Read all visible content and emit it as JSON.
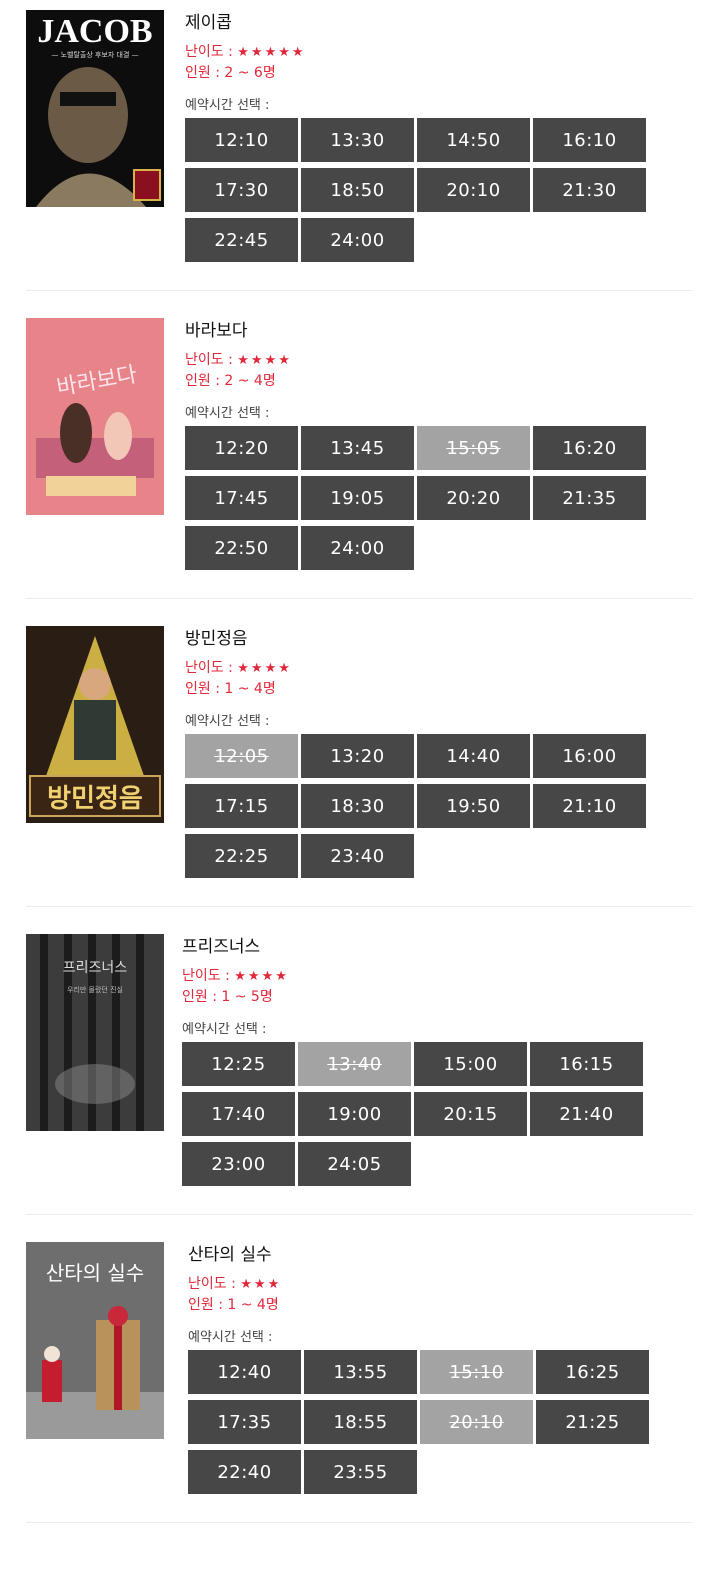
{
  "common": {
    "difficulty_label": "난이도 :",
    "select_label": "예약시간 선택 :"
  },
  "themes": [
    {
      "poster_text": "JACOB",
      "poster_subtext": "— 노벨탈출상 후보자 대결 —",
      "title": "제이콥",
      "stars": "★★★★★",
      "people": "인원 : 2 ~ 6명",
      "slots": [
        "12:10",
        "13:30",
        "14:50",
        "16:10",
        "17:30",
        "18:50",
        "20:10",
        "21:30",
        "22:45",
        "24:00"
      ],
      "closed": []
    },
    {
      "poster_text": "바라보다",
      "title": "바라보다",
      "stars": "★★★★",
      "people": "인원 : 2 ~ 4명",
      "slots": [
        "12:20",
        "13:45",
        "15:05",
        "16:20",
        "17:45",
        "19:05",
        "20:20",
        "21:35",
        "22:50",
        "24:00"
      ],
      "closed": [
        "15:05"
      ]
    },
    {
      "poster_text": "방민정음",
      "title": "방민정음",
      "stars": "★★★★",
      "people": "인원 : 1 ~ 4명",
      "slots": [
        "12:05",
        "13:20",
        "14:40",
        "16:00",
        "17:15",
        "18:30",
        "19:50",
        "21:10",
        "22:25",
        "23:40"
      ],
      "closed": [
        "12:05"
      ]
    },
    {
      "poster_text": "프리즈너스",
      "poster_subtext": "우리만 몰랐던 진실",
      "title": "프리즈너스",
      "stars": "★★★★",
      "people": "인원 : 1 ~ 5명",
      "slots": [
        "12:25",
        "13:40",
        "15:00",
        "16:15",
        "17:40",
        "19:00",
        "20:15",
        "21:40",
        "23:00",
        "24:05"
      ],
      "closed": [
        "13:40"
      ]
    },
    {
      "poster_text": "산타의 실수",
      "title": "산타의 실수",
      "stars": "★★★",
      "people": "인원 : 1 ~ 4명",
      "slots": [
        "12:40",
        "13:55",
        "15:10",
        "16:25",
        "17:35",
        "18:55",
        "20:10",
        "21:25",
        "22:40",
        "23:55"
      ],
      "closed": [
        "15:10",
        "20:10"
      ]
    }
  ],
  "colors": {
    "slot_open": "#474747",
    "slot_closed": "#a3a3a3",
    "accent": "#e0283a"
  }
}
